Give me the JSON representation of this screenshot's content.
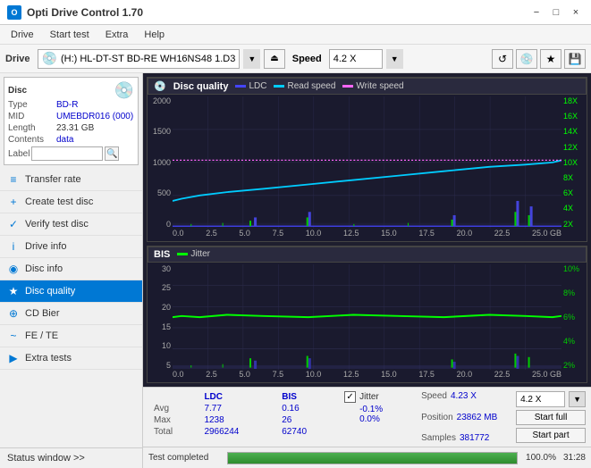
{
  "app": {
    "title": "Opti Drive Control 1.70",
    "icon": "O"
  },
  "titlebar": {
    "minimize": "−",
    "maximize": "□",
    "close": "×"
  },
  "menu": {
    "items": [
      "Drive",
      "Start test",
      "Extra",
      "Help"
    ]
  },
  "drivebar": {
    "label": "Drive",
    "drive_value": "(H:)  HL-DT-ST BD-RE  WH16NS48 1.D3",
    "speed_label": "Speed",
    "speed_value": "4.2 X"
  },
  "disc": {
    "type_label": "Type",
    "type_value": "BD-R",
    "mid_label": "MID",
    "mid_value": "UMEBDR016 (000)",
    "length_label": "Length",
    "length_value": "23.31 GB",
    "contents_label": "Contents",
    "contents_value": "data",
    "label_label": "Label",
    "label_value": ""
  },
  "sidebar": {
    "items": [
      {
        "id": "transfer-rate",
        "label": "Transfer rate",
        "icon": "≡"
      },
      {
        "id": "create-test-disc",
        "label": "Create test disc",
        "icon": "+"
      },
      {
        "id": "verify-test-disc",
        "label": "Verify test disc",
        "icon": "✓"
      },
      {
        "id": "drive-info",
        "label": "Drive info",
        "icon": "i"
      },
      {
        "id": "disc-info",
        "label": "Disc info",
        "icon": "◉"
      },
      {
        "id": "disc-quality",
        "label": "Disc quality",
        "icon": "★",
        "active": true
      },
      {
        "id": "cd-bier",
        "label": "CD Bier",
        "icon": "⊕"
      },
      {
        "id": "fe-te",
        "label": "FE / TE",
        "icon": "~"
      },
      {
        "id": "extra-tests",
        "label": "Extra tests",
        "icon": "▶"
      }
    ],
    "status_window": "Status window >>"
  },
  "chart1": {
    "title": "Disc quality",
    "legend": [
      {
        "label": "LDC",
        "color": "#4444ff"
      },
      {
        "label": "Read speed",
        "color": "#00ccff"
      },
      {
        "label": "Write speed",
        "color": "#ff66ff"
      }
    ],
    "y_axis_left": [
      "2000",
      "1500",
      "1000",
      "500",
      "0"
    ],
    "y_axis_right": [
      "18X",
      "16X",
      "14X",
      "12X",
      "10X",
      "8X",
      "6X",
      "4X",
      "2X"
    ],
    "x_axis": [
      "0.0",
      "2.5",
      "5.0",
      "7.5",
      "10.0",
      "12.5",
      "15.0",
      "17.5",
      "20.0",
      "22.5",
      "25.0"
    ],
    "x_unit": "GB"
  },
  "chart2": {
    "title": "BIS",
    "legend": [
      {
        "label": "Jitter",
        "color": "#00ff00"
      }
    ],
    "y_axis_left": [
      "30",
      "25",
      "20",
      "15",
      "10",
      "5"
    ],
    "y_axis_right": [
      "10%",
      "8%",
      "6%",
      "4%",
      "2%"
    ],
    "x_axis": [
      "0.0",
      "2.5",
      "5.0",
      "7.5",
      "10.0",
      "12.5",
      "15.0",
      "17.5",
      "20.0",
      "22.5",
      "25.0"
    ],
    "x_unit": "GB"
  },
  "stats": {
    "columns": [
      "",
      "LDC",
      "BIS",
      "",
      "",
      "Jitter"
    ],
    "rows": [
      {
        "label": "Avg",
        "ldc": "7.77",
        "bis": "0.16",
        "jitter": "-0.1%"
      },
      {
        "label": "Max",
        "ldc": "1238",
        "bis": "26",
        "jitter": "0.0%"
      },
      {
        "label": "Total",
        "ldc": "2966244",
        "bis": "62740",
        "jitter": ""
      }
    ],
    "speed_label": "Speed",
    "speed_value": "4.23 X",
    "position_label": "Position",
    "position_value": "23862 MB",
    "samples_label": "Samples",
    "samples_value": "381772",
    "speed_select_value": "4.2 X",
    "jitter_checked": true,
    "btn_start_full": "Start full",
    "btn_start_part": "Start part"
  },
  "progress": {
    "label": "Test completed",
    "percent": 100,
    "percent_label": "100.0%",
    "time": "31:28"
  }
}
